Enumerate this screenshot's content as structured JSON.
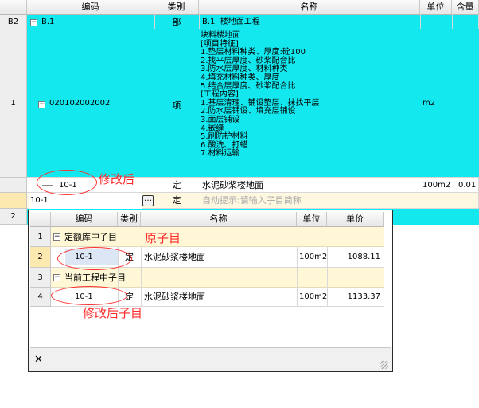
{
  "main_grid": {
    "columns": [
      "编码",
      "类别",
      "名称",
      "单位",
      "含量"
    ],
    "rows": [
      {
        "row_no": "B2",
        "code": "B.1",
        "type": "部",
        "name": "B.1  楼地面工程",
        "unit": "",
        "qty": ""
      },
      {
        "row_no": "1",
        "code": "020102002002",
        "type": "项",
        "name_lines": [
          "块料楼地面",
          "[项目特征]",
          "1.垫层材料种类、厚度:砼100",
          "2.找平层厚度、砂浆配合比",
          "3.防水层厚度、材料种类",
          "4.填充材料种类、厚度",
          "5.结合层厚度、砂浆配合比",
          "[工程内容]",
          "1.基层清理、铺设垫层、抹找平层",
          "2.防水层铺设、填充层铺设",
          "3.面层铺设",
          "4.嵌缝",
          "5.刷防护材料",
          "6.酸洗、打蜡",
          "7.材料运输"
        ],
        "unit": "m2",
        "qty": ""
      },
      {
        "row_no": "",
        "code": "10-1",
        "type": "定",
        "name": "水泥砂浆楼地面",
        "unit": "100m2",
        "qty": "0.01"
      },
      {
        "row_no": "",
        "code": "10-1",
        "type": "定",
        "name_placeholder": "自动提示:请输入子目简称",
        "unit": "",
        "qty": ""
      },
      {
        "row_no": "2",
        "code": "",
        "type": "",
        "name": "",
        "unit": "",
        "qty": ""
      }
    ]
  },
  "annotations": {
    "modified": "修改后",
    "original_sub": "原子目",
    "modified_sub": "修改后子目"
  },
  "popup": {
    "columns": [
      "编码",
      "类别",
      "名称",
      "单位",
      "单价"
    ],
    "rows": [
      {
        "row_no": "1",
        "group": "定额库中子目"
      },
      {
        "row_no": "2",
        "code": "10-1",
        "type": "定",
        "name": "水泥砂浆楼地面",
        "unit": "100m2",
        "price": "1088.11"
      },
      {
        "row_no": "3",
        "group": "当前工程中子目"
      },
      {
        "row_no": "4",
        "code": "10-1",
        "type": "定",
        "name": "水泥砂浆楼地面",
        "unit": "100m2",
        "price": "1133.37"
      }
    ],
    "close_symbol": "✕"
  },
  "icons": {
    "collapse": "−",
    "ellipsis": "…"
  },
  "colors": {
    "highlight": "#14e8ef",
    "annotation": "#ff2a2a",
    "selected_row": "#fff7d6"
  }
}
